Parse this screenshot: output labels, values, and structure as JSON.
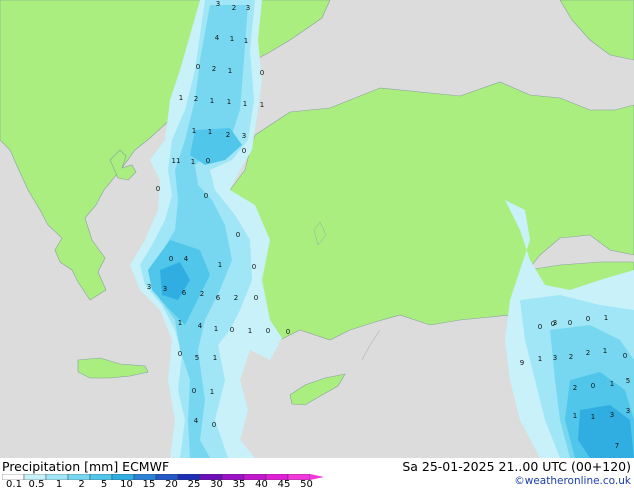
{
  "footer": {
    "title": "Precipitation [mm]  ECMWF",
    "datetime": "Sa 25-01-2025 21..00 UTC (00+120)",
    "credit": "©weatheronline.co.uk"
  },
  "legend": {
    "ticks": [
      "0.1",
      "0.5",
      "1",
      "2",
      "5",
      "10",
      "15",
      "20",
      "25",
      "30",
      "35",
      "40",
      "45",
      "50"
    ],
    "colors": [
      "#ffffff",
      "#c8f1fa",
      "#a0e6f6",
      "#78d7f0",
      "#50c6ea",
      "#30aee2",
      "#2a82d4",
      "#2358c6",
      "#1c2fb4",
      "#6b0fb8",
      "#9c12c6",
      "#c218ce",
      "#e020d6",
      "#f038dc"
    ]
  },
  "map": {
    "land_color": "#a9ee7f",
    "sea_color": "#dcdcdc",
    "precip_values": [
      {
        "v": "2"
      },
      {
        "v": "3"
      },
      {
        "v": "3"
      },
      {
        "v": "4"
      },
      {
        "v": "1"
      },
      {
        "v": "1"
      },
      {
        "v": "2"
      },
      {
        "v": "1"
      },
      {
        "v": "0"
      },
      {
        "v": "0"
      },
      {
        "v": "1"
      },
      {
        "v": "2"
      },
      {
        "v": "1"
      },
      {
        "v": "1"
      },
      {
        "v": "1"
      },
      {
        "v": "1"
      },
      {
        "v": "1"
      },
      {
        "v": "1"
      },
      {
        "v": "2"
      },
      {
        "v": "3"
      },
      {
        "v": "0"
      },
      {
        "v": "11"
      },
      {
        "v": "1"
      },
      {
        "v": "0"
      },
      {
        "v": "0"
      },
      {
        "v": "0"
      },
      {
        "v": "0"
      },
      {
        "v": "4"
      },
      {
        "v": "0"
      },
      {
        "v": "1"
      },
      {
        "v": "0"
      },
      {
        "v": "3"
      },
      {
        "v": "3"
      },
      {
        "v": "6"
      },
      {
        "v": "2"
      },
      {
        "v": "6"
      },
      {
        "v": "2"
      },
      {
        "v": "0"
      },
      {
        "v": "4"
      },
      {
        "v": "1"
      },
      {
        "v": "1"
      },
      {
        "v": "0"
      },
      {
        "v": "1"
      },
      {
        "v": "0"
      },
      {
        "v": "0"
      },
      {
        "v": "5"
      },
      {
        "v": "0"
      },
      {
        "v": "1"
      },
      {
        "v": "0"
      },
      {
        "v": "1"
      },
      {
        "v": "3"
      },
      {
        "v": "0"
      },
      {
        "v": "0"
      },
      {
        "v": "0"
      },
      {
        "v": "0"
      },
      {
        "v": "1"
      },
      {
        "v": "2"
      },
      {
        "v": "3"
      },
      {
        "v": "2"
      },
      {
        "v": "1"
      },
      {
        "v": "1"
      },
      {
        "v": "9"
      },
      {
        "v": "0"
      },
      {
        "v": "2"
      },
      {
        "v": "0"
      },
      {
        "v": "1"
      },
      {
        "v": "5"
      },
      {
        "v": "1"
      },
      {
        "v": "1"
      },
      {
        "v": "3"
      },
      {
        "v": "3"
      },
      {
        "v": "4"
      },
      {
        "v": "7"
      },
      {
        "v": "0"
      }
    ]
  }
}
